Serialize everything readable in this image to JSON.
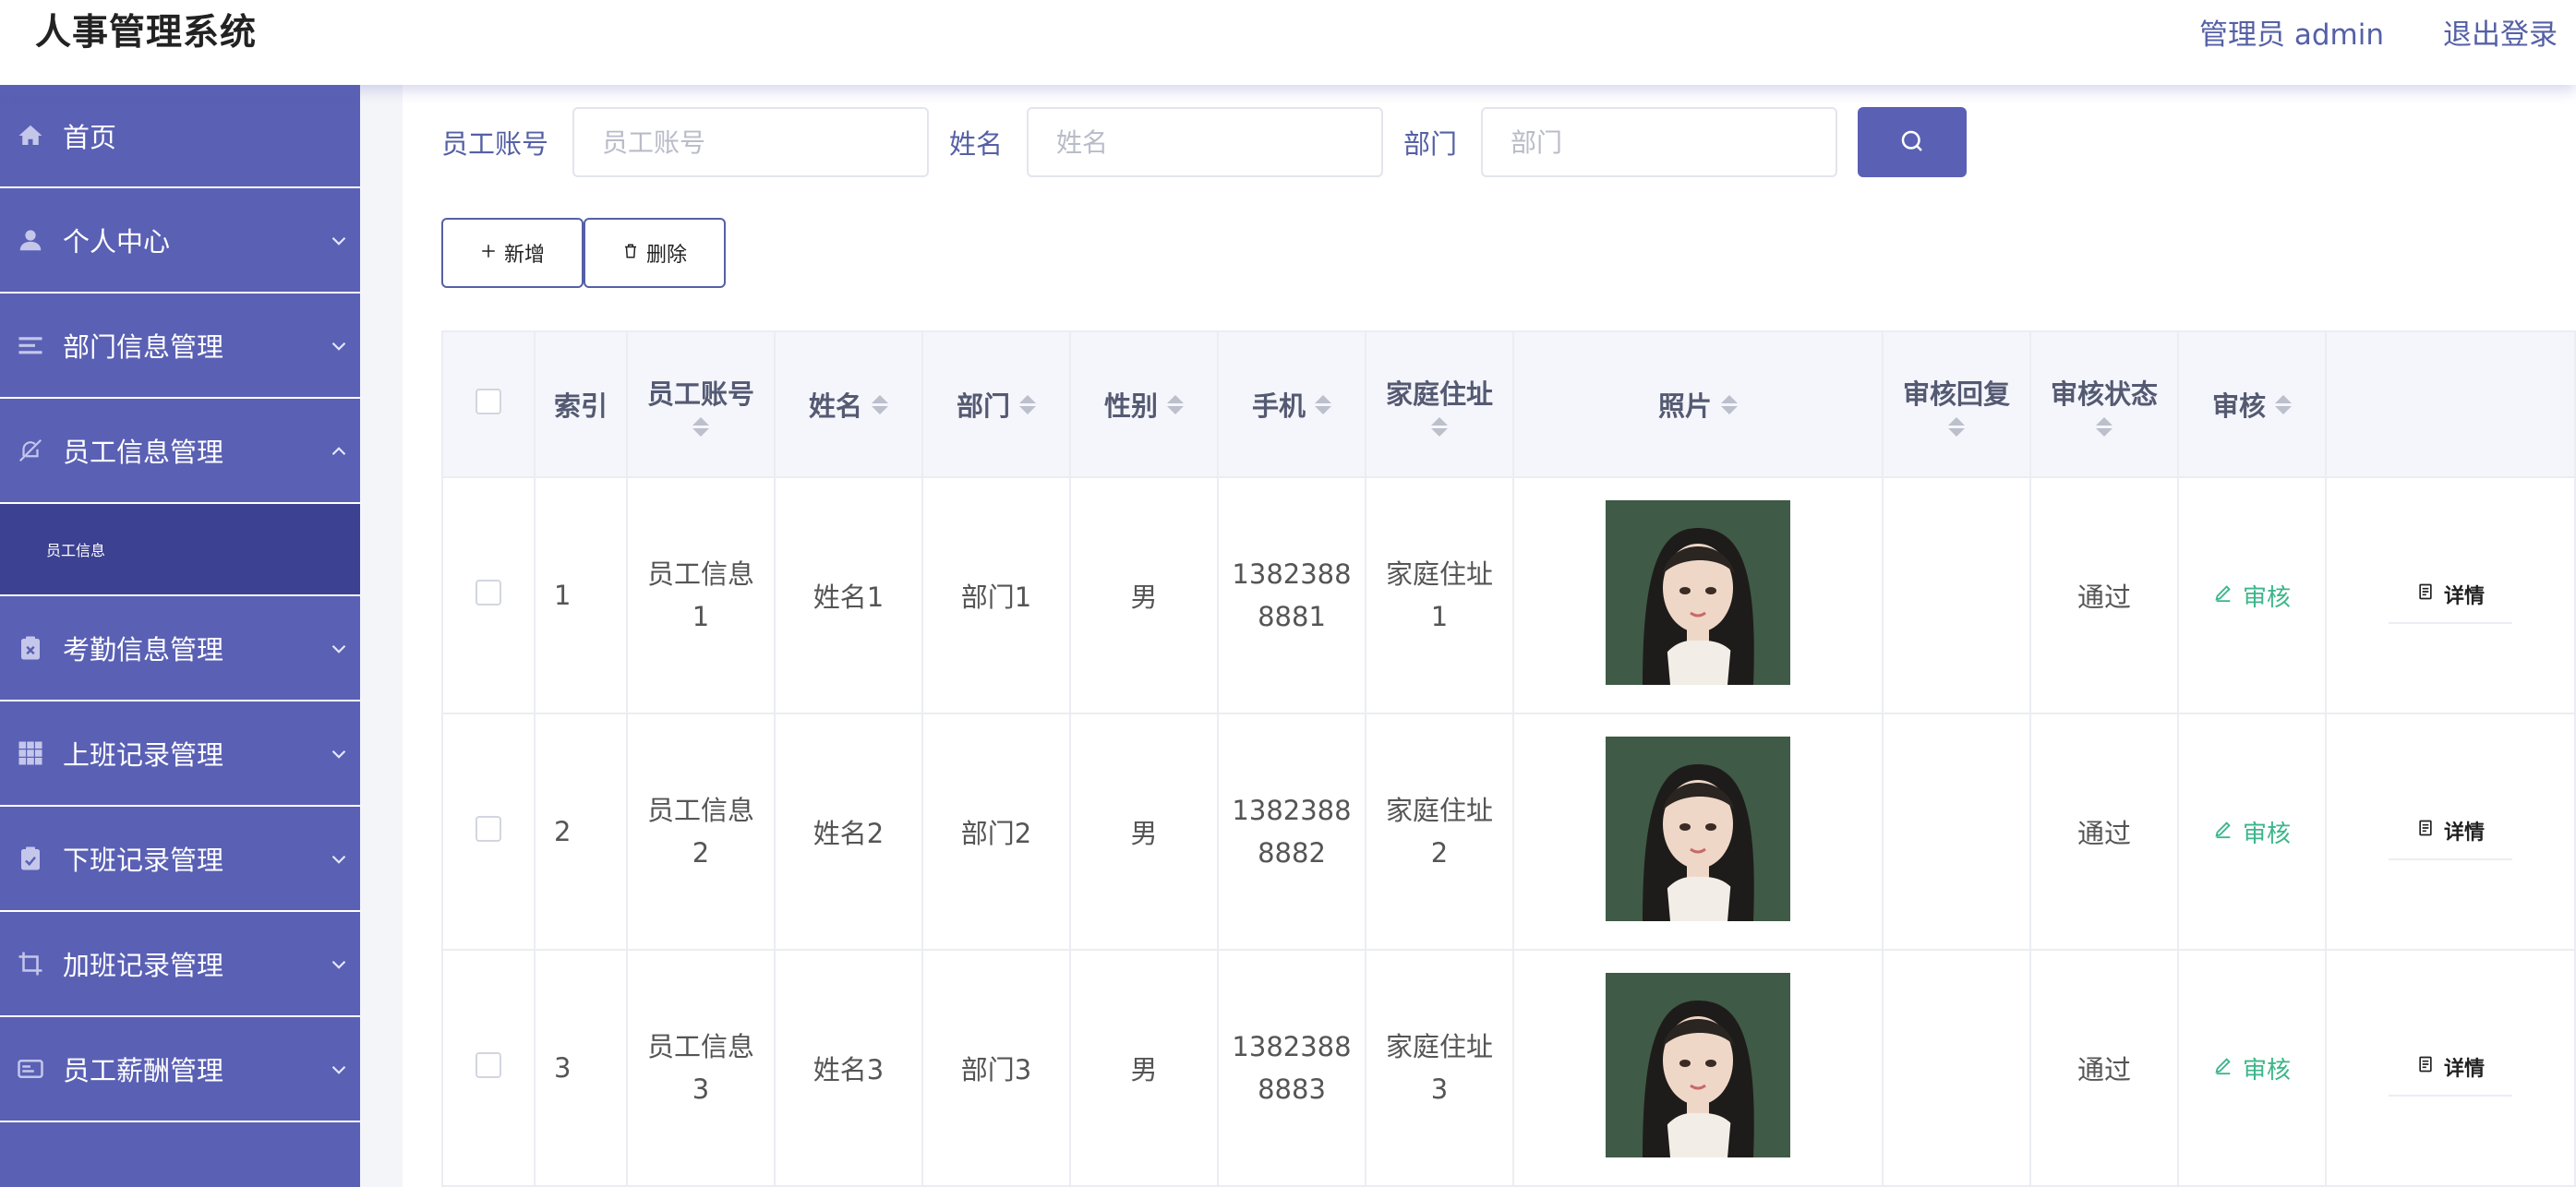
{
  "app": {
    "title": "人事管理系统"
  },
  "header": {
    "user": "管理员 admin",
    "logout": "退出登录"
  },
  "sidebar": {
    "items": [
      {
        "label": "首页",
        "icon": "home-icon",
        "chevron": false
      },
      {
        "label": "个人中心",
        "icon": "user-icon",
        "chevron": true
      },
      {
        "label": "部门信息管理",
        "icon": "list-icon",
        "chevron": true
      },
      {
        "label": "员工信息管理",
        "icon": "bell-off-icon",
        "chevron": true,
        "expanded": true,
        "sub": "员工信息"
      },
      {
        "label": "考勤信息管理",
        "icon": "clipboard-x-icon",
        "chevron": true
      },
      {
        "label": "上班记录管理",
        "icon": "grid-icon",
        "chevron": true
      },
      {
        "label": "下班记录管理",
        "icon": "clipboard-check-icon",
        "chevron": true
      },
      {
        "label": "加班记录管理",
        "icon": "crop-icon",
        "chevron": true
      },
      {
        "label": "员工薪酬管理",
        "icon": "card-icon",
        "chevron": true
      }
    ]
  },
  "search": {
    "account_label": "员工账号",
    "account_placeholder": "员工账号",
    "name_label": "姓名",
    "name_placeholder": "姓名",
    "dept_label": "部门",
    "dept_placeholder": "部门"
  },
  "actions": {
    "add": "新增",
    "delete": "删除"
  },
  "table": {
    "headers": {
      "index": "索引",
      "account": "员工账号",
      "name": "姓名",
      "dept": "部门",
      "gender": "性别",
      "phone": "手机",
      "address": "家庭住址",
      "photo": "照片",
      "reply": "审核回复",
      "status": "审核状态",
      "audit": "审核"
    },
    "rows": [
      {
        "index": "1",
        "account_1": "员工信息",
        "account_2": "1",
        "name": "姓名1",
        "dept": "部门1",
        "gender": "男",
        "phone_1": "1382388",
        "phone_2": "8881",
        "addr_1": "家庭住址",
        "addr_2": "1",
        "reply": "",
        "status": "通过",
        "audit": "审核",
        "detail": "详情"
      },
      {
        "index": "2",
        "account_1": "员工信息",
        "account_2": "2",
        "name": "姓名2",
        "dept": "部门2",
        "gender": "男",
        "phone_1": "1382388",
        "phone_2": "8882",
        "addr_1": "家庭住址",
        "addr_2": "2",
        "reply": "",
        "status": "通过",
        "audit": "审核",
        "detail": "详情"
      },
      {
        "index": "3",
        "account_1": "员工信息",
        "account_2": "3",
        "name": "姓名3",
        "dept": "部门3",
        "gender": "男",
        "phone_1": "1382388",
        "phone_2": "8883",
        "addr_1": "家庭住址",
        "addr_2": "3",
        "reply": "",
        "status": "通过",
        "audit": "审核",
        "detail": "详情"
      }
    ]
  },
  "colors": {
    "accent": "#5a60b4",
    "sidebar_active": "#3d4191",
    "success": "#3bb68a",
    "link": "#5560a6"
  }
}
